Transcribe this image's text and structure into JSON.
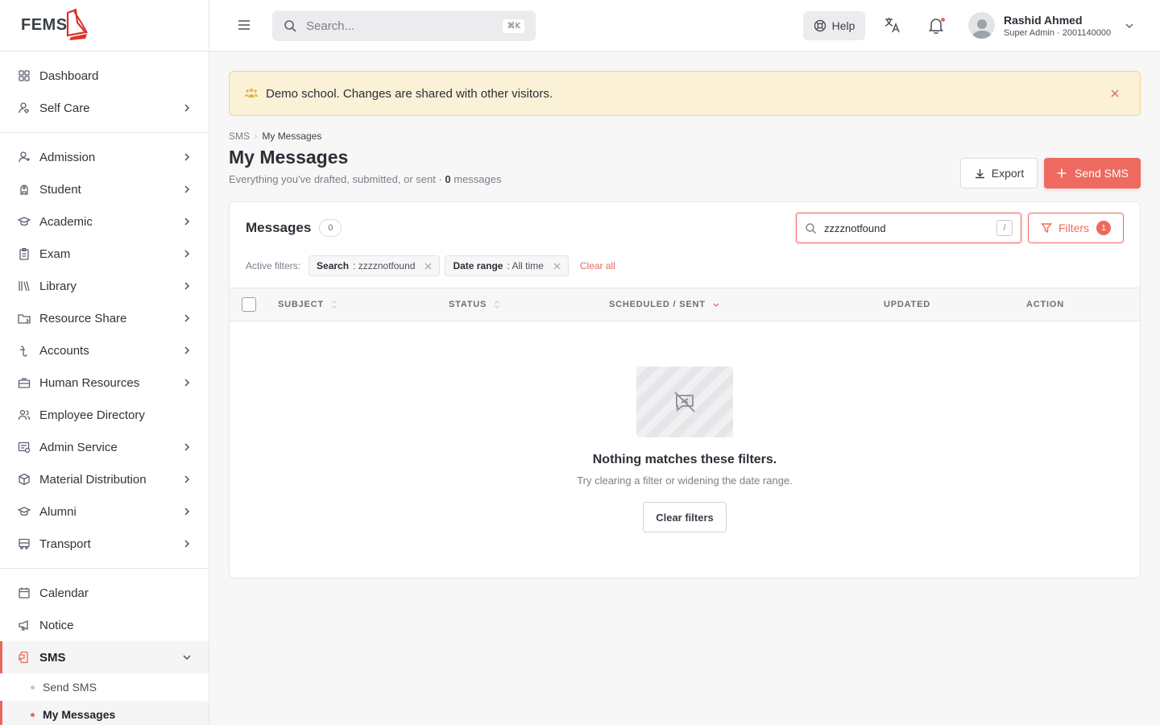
{
  "app": {
    "logo_text": "FEMS",
    "brand_color": "#e8685e"
  },
  "sidebar": {
    "groups": [
      [
        {
          "label": "Dashboard",
          "icon": "grid-icon",
          "chevron": false
        },
        {
          "label": "Self Care",
          "icon": "user-heart-icon",
          "chevron": true
        }
      ],
      [
        {
          "label": "Admission",
          "icon": "user-plus-icon",
          "chevron": true
        },
        {
          "label": "Student",
          "icon": "student-icon",
          "chevron": true
        },
        {
          "label": "Academic",
          "icon": "graduation-cap-icon",
          "chevron": true
        },
        {
          "label": "Exam",
          "icon": "clipboard-icon",
          "chevron": true
        },
        {
          "label": "Library",
          "icon": "library-icon",
          "chevron": true
        },
        {
          "label": "Resource Share",
          "icon": "folder-share-icon",
          "chevron": true
        },
        {
          "label": "Accounts",
          "icon": "currency-icon",
          "chevron": true
        },
        {
          "label": "Human Resources",
          "icon": "briefcase-icon",
          "chevron": true
        },
        {
          "label": "Employee Directory",
          "icon": "users-icon",
          "chevron": false
        },
        {
          "label": "Admin Service",
          "icon": "admin-service-icon",
          "chevron": true
        },
        {
          "label": "Material Distribution",
          "icon": "box-icon",
          "chevron": true
        },
        {
          "label": "Alumni",
          "icon": "graduation-cap-icon",
          "chevron": true
        },
        {
          "label": "Transport",
          "icon": "bus-icon",
          "chevron": true
        }
      ],
      [
        {
          "label": "Calendar",
          "icon": "calendar-icon",
          "chevron": false
        },
        {
          "label": "Notice",
          "icon": "megaphone-icon",
          "chevron": false
        },
        {
          "label": "SMS",
          "icon": "sms-icon",
          "chevron": true,
          "active": true,
          "expanded": true
        }
      ]
    ],
    "sms_sub": [
      {
        "label": "Send SMS",
        "active": false
      },
      {
        "label": "My Messages",
        "active": true
      }
    ]
  },
  "topbar": {
    "search_placeholder": "Search...",
    "search_shortcut": "⌘K",
    "help_label": "Help",
    "user_name": "Rashid Ahmed",
    "user_role": "Super Admin · 2001140000"
  },
  "banner": {
    "text": "Demo school. Changes are shared with other visitors."
  },
  "breadcrumb": {
    "parent": "SMS",
    "current": "My Messages"
  },
  "page": {
    "title": "My Messages",
    "subtitle_prefix": "Everything you've drafted, submitted, or sent · ",
    "message_count": "0",
    "subtitle_suffix": " messages",
    "export_label": "Export",
    "send_label": "Send SMS"
  },
  "messages_card": {
    "title": "Messages",
    "count": "0",
    "search_value": "zzzznotfound",
    "search_shortcut": "/",
    "filters_label": "Filters",
    "filters_count": "1",
    "active_filters_label": "Active filters:",
    "chips": [
      {
        "key": "Search",
        "value": ": zzzznotfound"
      },
      {
        "key": "Date range",
        "value": ": All time"
      }
    ],
    "clear_all_label": "Clear all",
    "columns": [
      "SUBJECT",
      "STATUS",
      "SCHEDULED / SENT",
      "UPDATED",
      "ACTION"
    ],
    "empty_title": "Nothing matches these filters.",
    "empty_subtitle": "Try clearing a filter or widening the date range.",
    "clear_filters_label": "Clear filters"
  }
}
